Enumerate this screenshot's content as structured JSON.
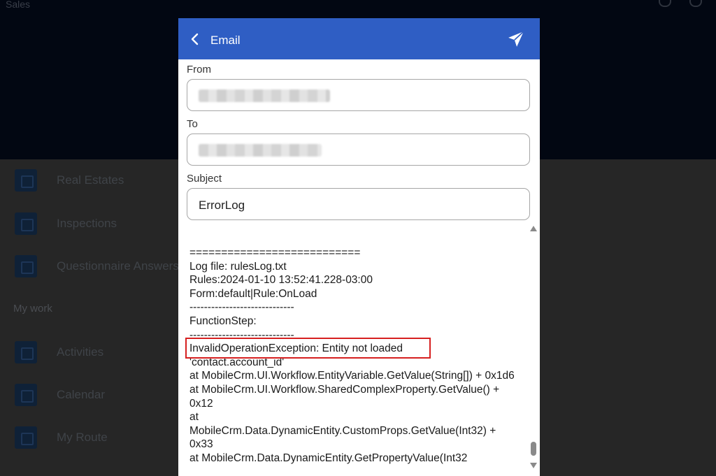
{
  "background": {
    "app_title": "Sales",
    "nav_items": [
      {
        "label": "Real Estates",
        "icon": "building-icon"
      },
      {
        "label": "Inspections",
        "icon": "clipboard-icon"
      },
      {
        "label": "Questionnaire Answers",
        "icon": "questionnaire-icon"
      },
      {
        "label": "Activities",
        "icon": "checklist-icon"
      },
      {
        "label": "Calendar",
        "icon": "calendar-icon"
      },
      {
        "label": "My Route",
        "icon": "route-icon"
      }
    ],
    "section_my_work": "My work"
  },
  "dialog": {
    "title": "Email",
    "back_icon": "chevron-left-icon",
    "send_icon": "send-icon",
    "header_color": "#2f5ec4",
    "from_label": "From",
    "to_label": "To",
    "subject_label": "Subject",
    "subject_value": "ErrorLog",
    "body": "===========================\nLog file: rulesLog.txt\nRules:2024-01-10 13:52:41.228-03:00\nForm:default|Rule:OnLoad\n-----------------------------\nFunctionStep:\n-----------------------------\nInvalidOperationException: Entity not loaded\n'contact.account_id'\nat MobileCrm.UI.Workflow.EntityVariable.GetValue(String[]) + 0x1d6\nat MobileCrm.UI.Workflow.SharedComplexProperty.GetValue() + 0x12\nat\nMobileCrm.Data.DynamicEntity.CustomProps.GetValue(Int32) + 0x33\nat MobileCrm.Data.DynamicEntity.GetPropertyValue(Int32"
  },
  "colors": {
    "highlight_border": "#d62020"
  }
}
